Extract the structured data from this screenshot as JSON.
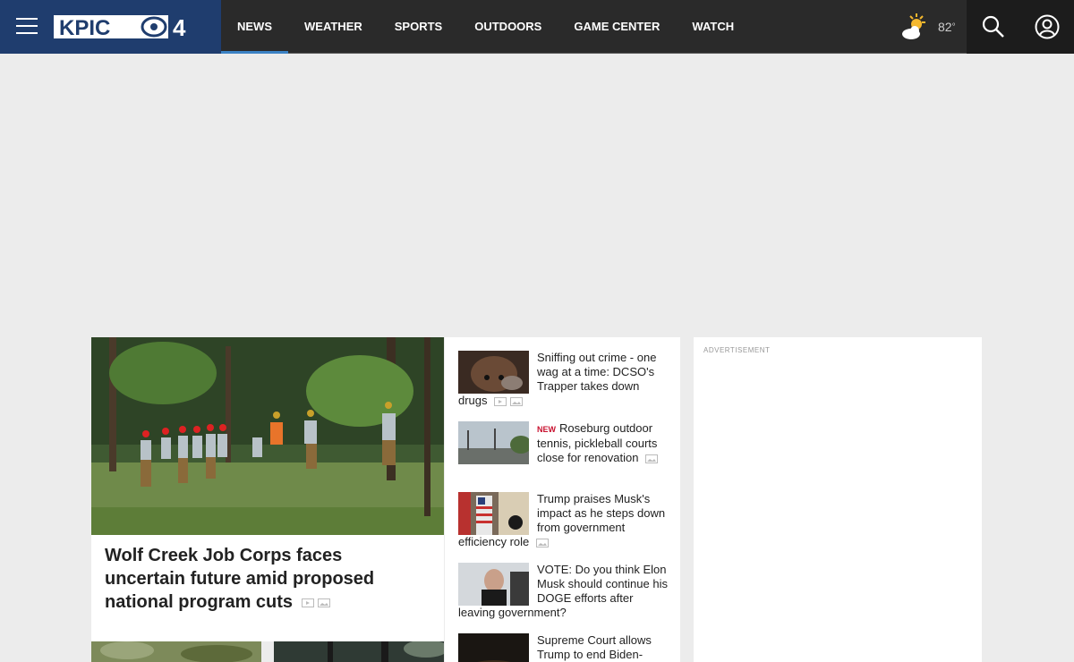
{
  "brand": {
    "logo_text": "KPIC"
  },
  "nav": {
    "items": [
      {
        "label": "NEWS",
        "active": true
      },
      {
        "label": "WEATHER"
      },
      {
        "label": "SPORTS"
      },
      {
        "label": "OUTDOORS"
      },
      {
        "label": "GAME CENTER"
      },
      {
        "label": "WATCH"
      }
    ]
  },
  "weather": {
    "temperature": "82",
    "degree_symbol": "°",
    "icon": "partly-sunny-icon"
  },
  "lead": {
    "title": "Wolf Creek Job Corps faces uncertain future amid proposed national program cuts"
  },
  "stories": [
    {
      "title": "Sniffing out crime - one wag at a time: DCSO's Trapper takes down drugs",
      "new": false
    },
    {
      "title": "Roseburg outdoor tennis, pickleball courts close for renovation",
      "new": true,
      "new_label": "NEW"
    },
    {
      "title": "Trump praises Musk's impact as he steps down from government efficiency role",
      "new": false
    },
    {
      "title": "VOTE: Do you think Elon Musk should continue his DOGE efforts after leaving government?",
      "new": false
    },
    {
      "title": "Supreme Court allows Trump to end Biden-",
      "new": false
    }
  ],
  "ad": {
    "label": "ADVERTISEMENT"
  },
  "colors": {
    "brand_blue": "#1f3d6e",
    "header_bg": "#2a2a2a",
    "active_underline": "#3b82c4",
    "new_tag": "#c8102e"
  }
}
